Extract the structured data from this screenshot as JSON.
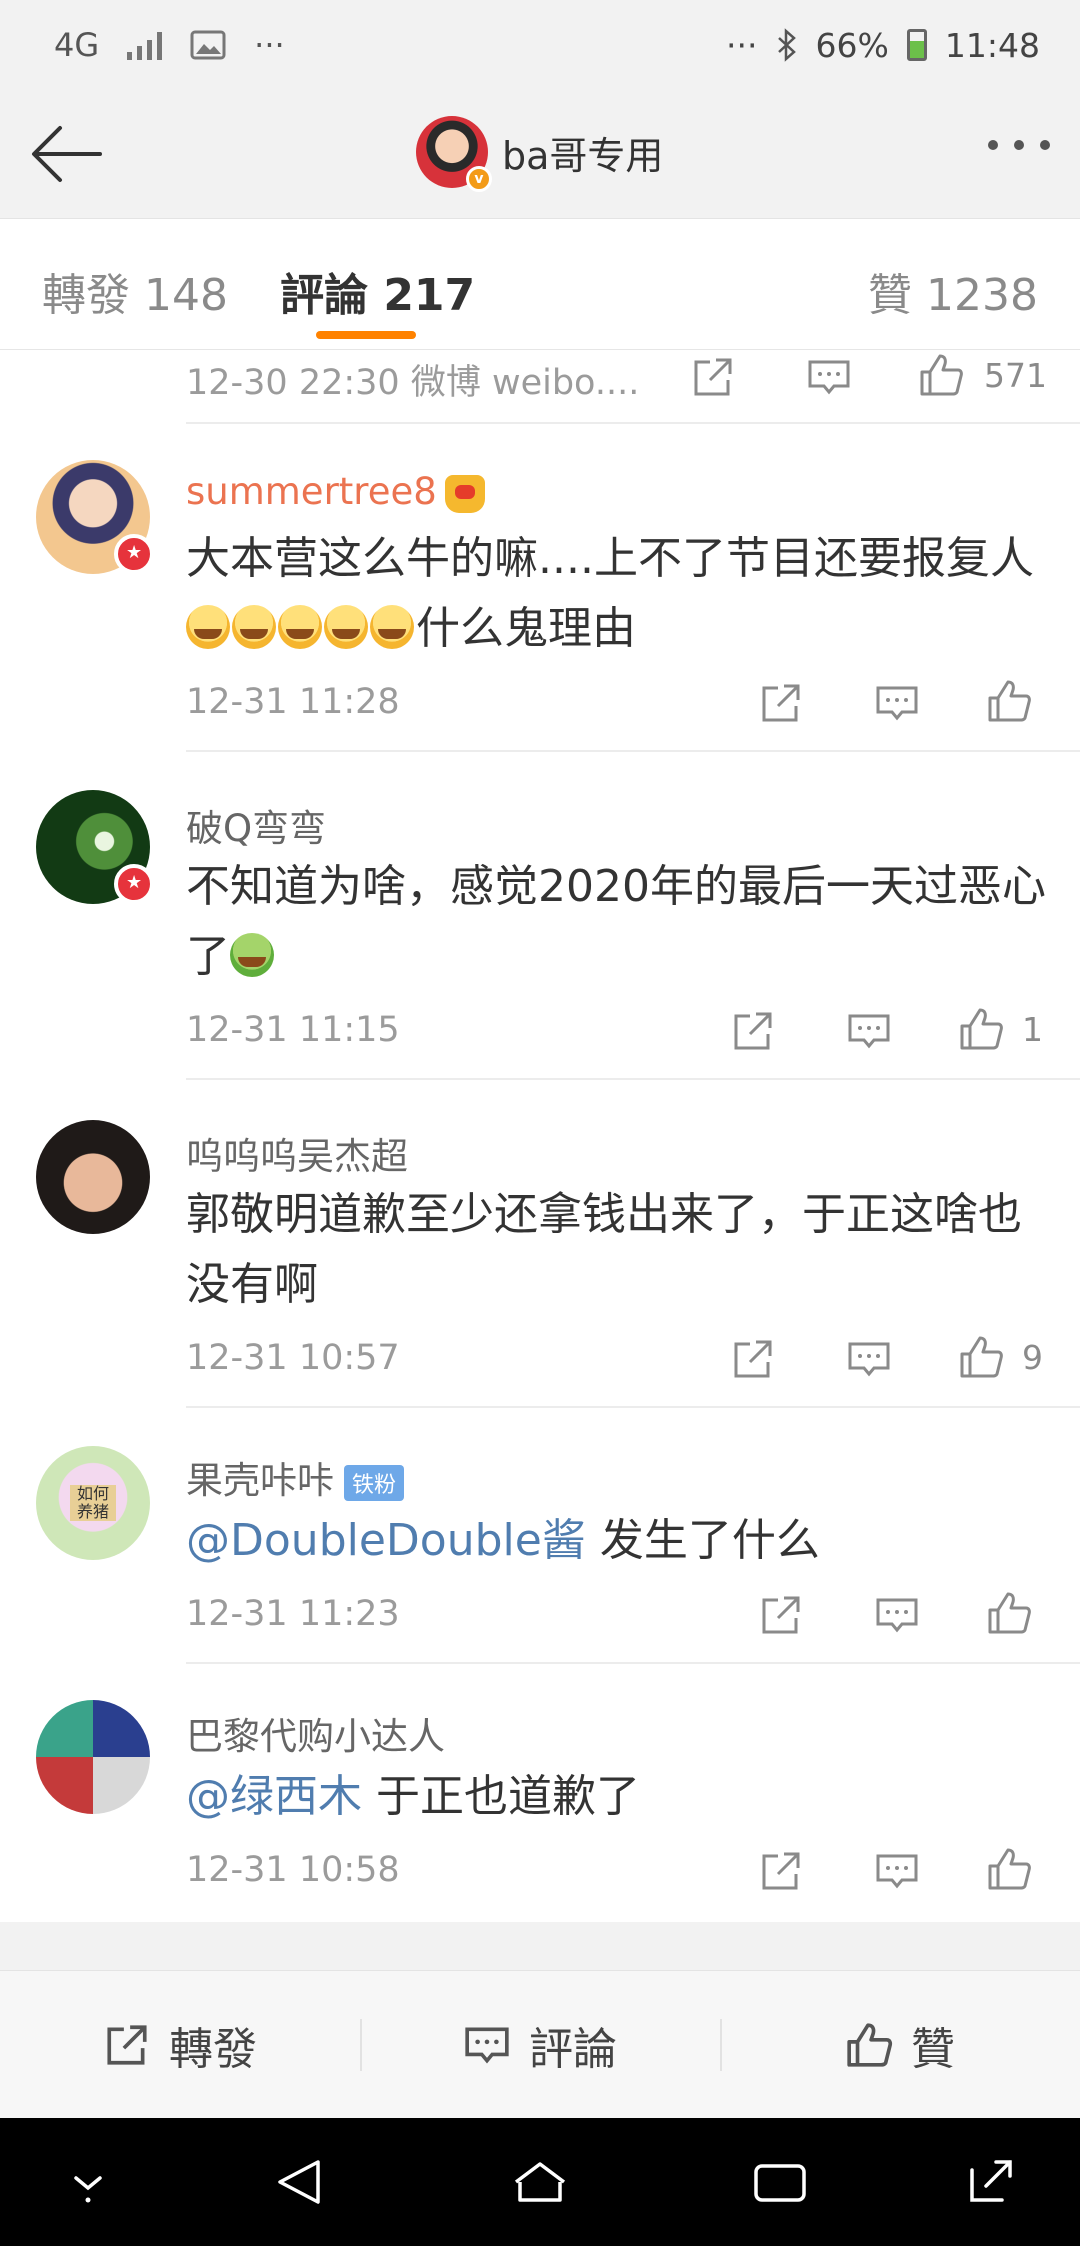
{
  "status_bar": {
    "network": "4G",
    "left_more": "···",
    "right_more": "···",
    "battery": "66%",
    "time": "11:48"
  },
  "nav": {
    "title": "ba哥专用",
    "verified_mark": "v"
  },
  "tabs": {
    "repost": "轉發 148",
    "comment": "評論 217",
    "like": "贊 1238"
  },
  "top_partial": {
    "meta": "12-30 22:30  微博  weibo....",
    "likes": "571"
  },
  "comments": [
    {
      "user": "summertree8",
      "text_a": "大本营这么牛的嘛....上不了节目还要报复人",
      "text_b": "什么鬼理由",
      "time": "12-31 11:28",
      "likes": ""
    },
    {
      "user": "破Q弯弯",
      "text": "不知道为啥，感觉2020年的最后一天过恶心了",
      "time": "12-31 11:15",
      "likes": "1"
    },
    {
      "user": "呜呜呜吴杰超",
      "text": "郭敬明道歉至少还拿钱出来了，于正这啥也没有啊",
      "time": "12-31 10:57",
      "likes": "9"
    },
    {
      "user": "果壳咔咔",
      "badge": "铁粉",
      "mention": "@DoubleDouble酱",
      "text": " 发生了什么",
      "time": "12-31 11:23",
      "likes": "",
      "avatar_text": "如何养猪"
    },
    {
      "user": "巴黎代购小达人",
      "mention": "@绿西木",
      "text": " 于正也道歉了",
      "time": "12-31 10:58",
      "likes": ""
    }
  ],
  "bottom_bar": {
    "repost": "轉發",
    "comment": "評論",
    "like": "贊"
  },
  "colors": {
    "accent": "#ff8200",
    "mention": "#507daf",
    "vip_name": "#eb7350"
  },
  "icons": [
    "back-arrow-icon",
    "more-icon",
    "share-icon",
    "comment-icon",
    "like-icon",
    "bluetooth-icon",
    "battery-icon",
    "signal-icon",
    "image-icon"
  ]
}
